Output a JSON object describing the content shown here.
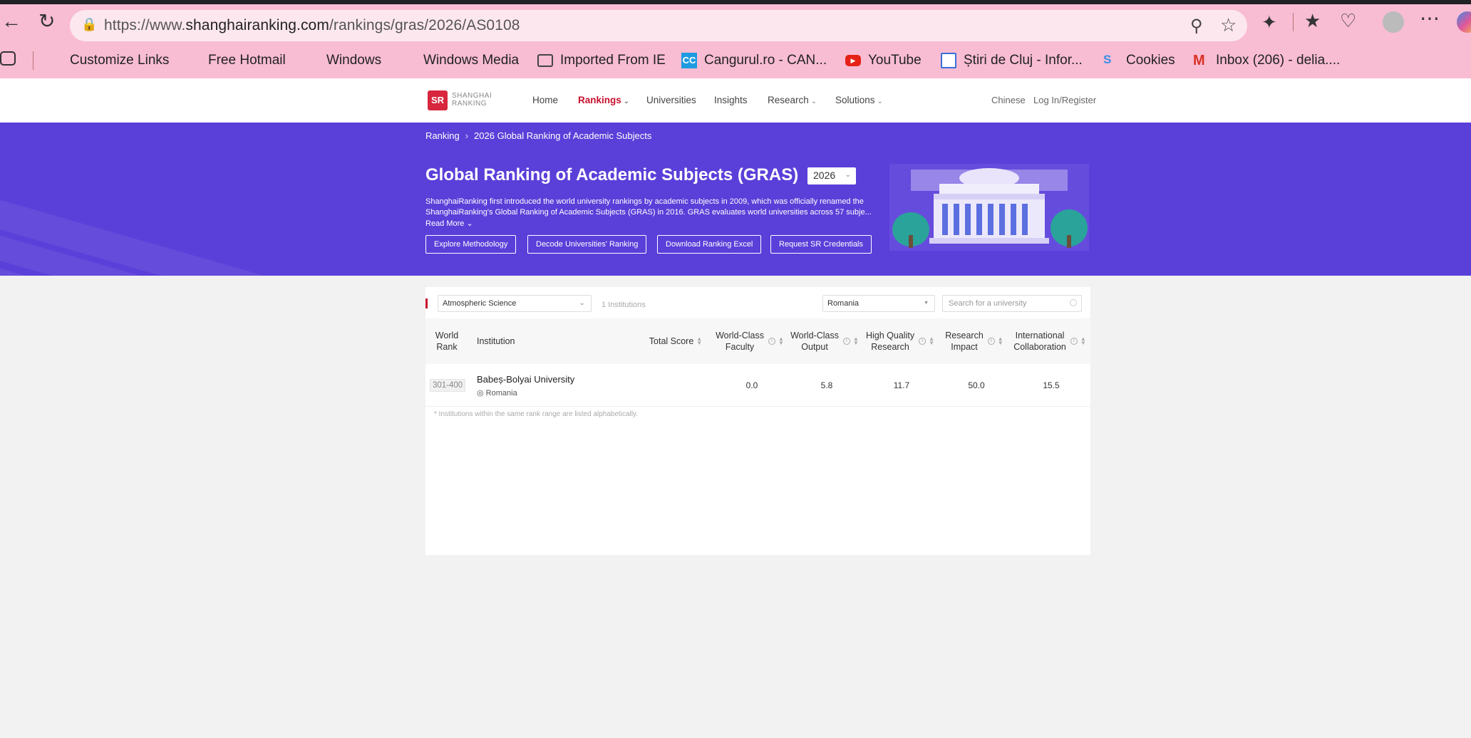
{
  "browser": {
    "url_prefix": "https://www.",
    "url_domain": "shanghairanking.com",
    "url_path": "/rankings/gras/2026/AS0108",
    "bookmarks": [
      {
        "label": "Customize Links"
      },
      {
        "label": "Free Hotmail"
      },
      {
        "label": "Windows"
      },
      {
        "label": "Windows Media"
      },
      {
        "label": "Imported From IE"
      },
      {
        "label": "Cangurul.ro - CAN..."
      },
      {
        "label": "YouTube"
      },
      {
        "label": "Știri de Cluj - Infor..."
      },
      {
        "label": "Cookies"
      },
      {
        "label": "Inbox (206) - delia...."
      }
    ],
    "colors": {
      "chrome": "#f8bcd3",
      "url_bar": "#fde7ef"
    }
  },
  "header": {
    "logo_mark": "SR",
    "logo_line1": "SHANGHAI",
    "logo_line2": "RANKING",
    "nav": [
      {
        "label": "Home"
      },
      {
        "label": "Rankings"
      },
      {
        "label": "Universities"
      },
      {
        "label": "Insights"
      },
      {
        "label": "Research"
      },
      {
        "label": "Solutions"
      }
    ],
    "lang": "Chinese",
    "login": "Log In/Register",
    "accent": "#c8102e"
  },
  "banner": {
    "breadcrumb_root": "Ranking",
    "breadcrumb_current": "2026 Global Ranking of Academic Subjects",
    "title": "Global Ranking of Academic Subjects (GRAS)",
    "year": "2026",
    "description": "ShanghaiRanking first introduced the world university rankings by academic subjects in 2009, which was officially renamed the ShanghaiRanking's Global Ranking of Academic Subjects (GRAS) in 2016. GRAS evaluates world universities across 57 subje...",
    "read_more": "Read More",
    "buttons": [
      {
        "label": "Explore Methodology"
      },
      {
        "label": "Decode Universities' Ranking"
      },
      {
        "label": "Download Ranking Excel"
      },
      {
        "label": "Request SR Credentials"
      }
    ],
    "color": "#5b3fd9"
  },
  "filters": {
    "subject": "Atmospheric Science",
    "count": "1 Institutions",
    "country": "Romania",
    "search_placeholder": "Search for a university"
  },
  "table": {
    "columns": {
      "world_rank_1": "World",
      "world_rank_2": "Rank",
      "institution": "Institution",
      "total_score": "Total Score",
      "wcf_1": "World-Class",
      "wcf_2": "Faculty",
      "wco_1": "World-Class",
      "wco_2": "Output",
      "hqr_1": "High Quality",
      "hqr_2": "Research",
      "ri_1": "Research",
      "ri_2": "Impact",
      "ic_1": "International",
      "ic_2": "Collaboration"
    },
    "rows": [
      {
        "rank": "301-400",
        "institution": "Babeș-Bolyai University",
        "country": "Romania",
        "total_score": "",
        "wcf": "0.0",
        "wco": "5.8",
        "hqr": "11.7",
        "ri": "50.0",
        "ic": "15.5"
      }
    ],
    "footnote": "* Institutions within the same rank range are listed alphabetically."
  }
}
